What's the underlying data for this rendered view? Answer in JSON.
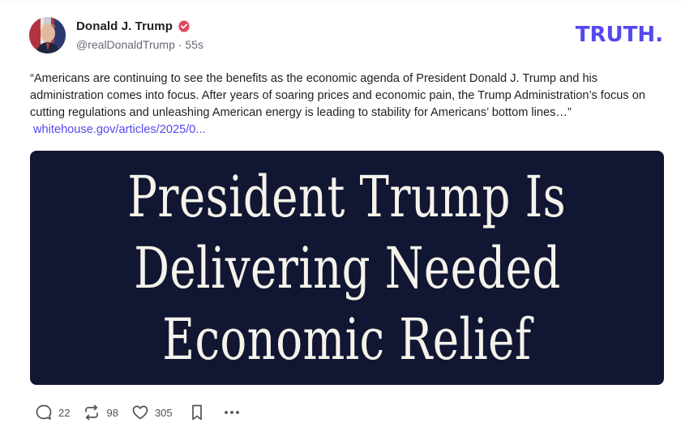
{
  "post": {
    "author": {
      "display_name": "Donald J. Trump",
      "handle": "@realDonaldTrump",
      "separator": " · ",
      "timestamp": "55s",
      "verified": true
    },
    "brand": {
      "logo_text": "TRUTH.",
      "color": "#5448ee"
    },
    "body_text": "“Americans are continuing to see the benefits as the economic agenda of President Donald J. Trump and his administration comes into focus. After years of soaring prices and economic pain, the Trump Administration’s focus on cutting regulations and unleashing American energy is leading to stability for Americans’ bottom lines…”",
    "link_text": "whitehouse.gov/articles/2025/0...",
    "media": {
      "lines": [
        "President Trump Is",
        "Delivering Needed",
        "Economic Relief"
      ],
      "background": "#111633"
    },
    "actions": {
      "replies": "22",
      "reposts": "98",
      "likes": "305"
    }
  },
  "icons": {
    "verified": "verified-badge-icon",
    "reply": "reply-bubble-icon",
    "repost": "repost-arrows-icon",
    "like": "heart-icon",
    "bookmark": "bookmark-icon",
    "more": "more-dots-icon"
  }
}
